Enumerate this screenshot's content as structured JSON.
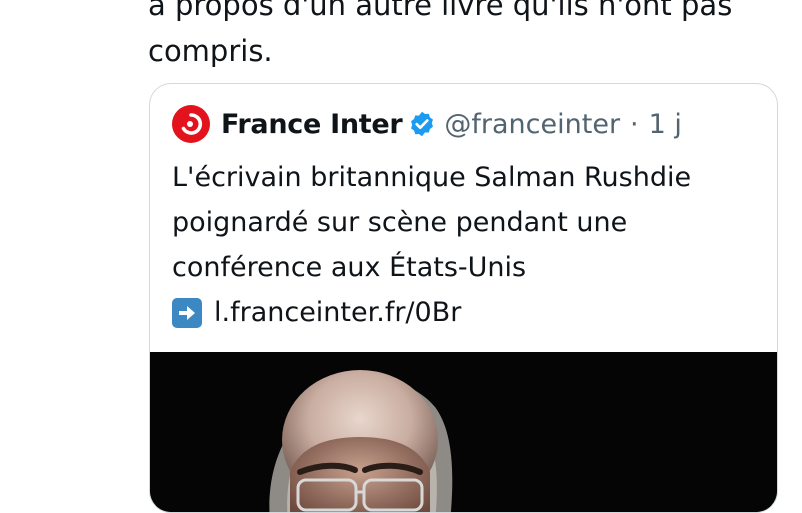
{
  "tweet": {
    "text_line1": "à propos d'un autre livre qu'ils n'ont pas",
    "text_line2": "compris."
  },
  "quote": {
    "display_name": "France Inter",
    "handle": "@franceinter",
    "separator": "·",
    "time": "1 j",
    "text_line1": "L'écrivain britannique Salman Rushdie",
    "text_line2": "poignardé sur scène pendant une",
    "text_line3": "conférence aux États-Unis",
    "link": "l.franceinter.fr/0Br",
    "icons": {
      "avatar": "france-inter-logo",
      "verified": "verified-badge-icon",
      "arrow": "right-arrow-emoji-icon"
    }
  },
  "colors": {
    "brand_red": "#e2131d",
    "verified_blue": "#1d9bf0",
    "secondary_text": "#536471",
    "border": "#cfd9de"
  }
}
